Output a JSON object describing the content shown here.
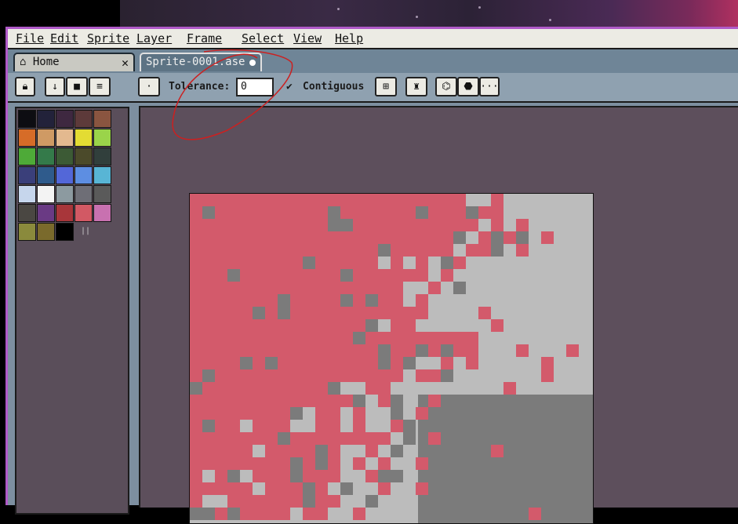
{
  "menu": [
    "File",
    "Edit",
    "Sprite",
    "Layer",
    "Frame",
    "Select",
    "View",
    "Help"
  ],
  "tabs": {
    "home": "Home",
    "sprite": "Sprite-0001.ase"
  },
  "toolbar": {
    "tolerance_label": "Tolerance:",
    "tolerance_value": "0",
    "contiguous_label": "Contiguous"
  },
  "colors": {
    "menubar_bg": "#ecebe4",
    "window_border": "#b05ac8",
    "editor_bg": "#5d4f5c",
    "selection_red": "#d35a6b",
    "canvas_light": "#bcbcbc",
    "canvas_dark": "#7b7b7b",
    "annotation": "#cc2020"
  },
  "palette": [
    "#0d0d12",
    "#22223a",
    "#3e2840",
    "#5d3a3a",
    "#8a5540",
    "#d66c28",
    "#cf9a64",
    "#e3b98f",
    "#e3dc33",
    "#9ad44a",
    "#4eaa38",
    "#347a4a",
    "#3c5a35",
    "#4b4a2a",
    "#313f3c",
    "#3a3f7a",
    "#2f5b8c",
    "#5367d8",
    "#5d8ee2",
    "#58b5d5",
    "#c6d6ec",
    "#f3f3f3",
    "#8c9aa0",
    "#6e6e76",
    "#5a5a5a",
    "#4a4742",
    "#6a3a84",
    "#a8363a",
    "#d25964",
    "#c871b0",
    "#8a8a3c",
    "#7a6a2c",
    "#000000"
  ],
  "icons": {
    "home": "home-icon",
    "close": "close-icon",
    "modified": "modified-dot-icon",
    "lock": "lock-icon",
    "down": "arrow-down-icon",
    "stop": "square-icon",
    "menu": "hamburger-icon",
    "brush": "pixel-brush-icon",
    "check": "checkmark-icon",
    "pixel_perfect": "pixel-perfect-icon",
    "ink": "ink-bottle-icon",
    "sym_v": "symmetry-vertical-icon",
    "sym_h": "symmetry-horizontal-icon",
    "more": "more-options-icon"
  }
}
